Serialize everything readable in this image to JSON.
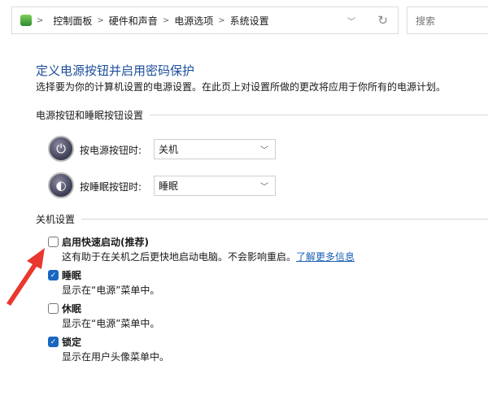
{
  "address_bar": {
    "breadcrumbs": [
      "控制面板",
      "硬件和声音",
      "电源选项",
      "系统设置"
    ],
    "search_placeholder": "搜索"
  },
  "title": "定义电源按钮并启用密码保护",
  "subtitle": "选择要为你的计算机设置的电源设置。在此页上对设置所做的更改将应用于你所有的电源计划。",
  "button_section": {
    "heading": "电源按钮和睡眠按钮设置",
    "rows": [
      {
        "label": "按电源按钮时:",
        "value": "关机",
        "icon": "power-icon"
      },
      {
        "label": "按睡眠按钮时:",
        "value": "睡眠",
        "icon": "sleep-icon"
      }
    ]
  },
  "shutdown_section": {
    "heading": "关机设置",
    "options": [
      {
        "label": "启用快速启动(推荐)",
        "checked": false,
        "desc": "这有助于在关机之后更快地启动电脑。不会影响重启。",
        "link": "了解更多信息"
      },
      {
        "label": "睡眠",
        "checked": true,
        "desc": "显示在“电源”菜单中。"
      },
      {
        "label": "休眠",
        "checked": false,
        "desc": "显示在“电源”菜单中。"
      },
      {
        "label": "锁定",
        "checked": true,
        "desc": "显示在用户头像菜单中。"
      }
    ]
  },
  "colors": {
    "title": "#1c4e9a",
    "checkbox": "#1a66c0",
    "arrow": "#e8382f"
  }
}
